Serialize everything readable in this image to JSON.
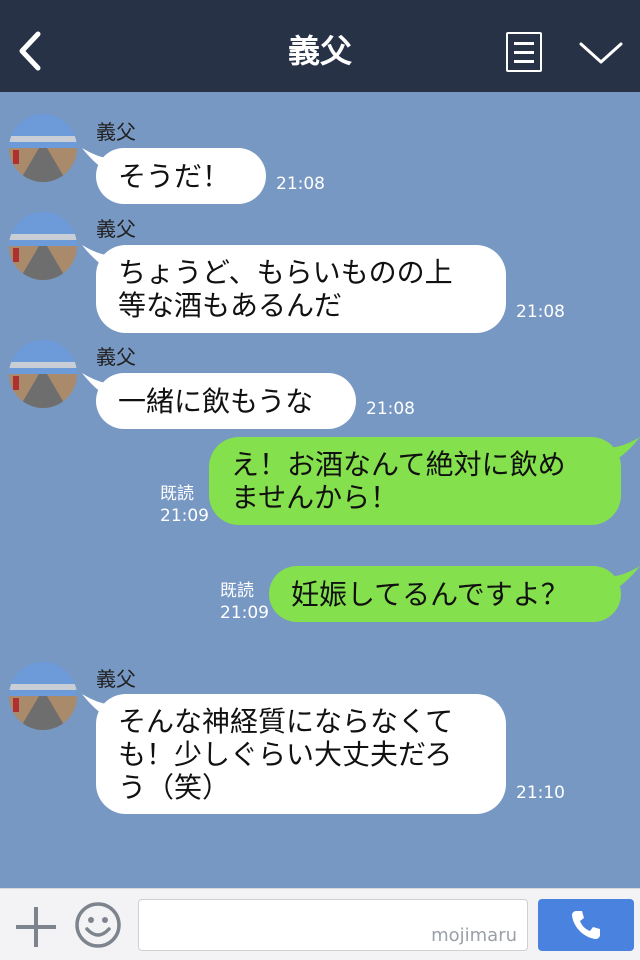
{
  "header": {
    "title": "義父"
  },
  "messages": [
    {
      "sender": "義父",
      "text": "そうだ！",
      "time": "21:08"
    },
    {
      "sender": "義父",
      "text": "ちょうど、もらいものの上\n等な酒もあるんだ",
      "time": "21:08"
    },
    {
      "sender": "義父",
      "text": "一緒に飲もうな",
      "time": "21:08"
    },
    {
      "read_label": "既読",
      "text": "え！お酒なんて絶対に飲め\nませんから！",
      "time": "21:09"
    },
    {
      "read_label": "既読",
      "text": "妊娠してるんですよ？",
      "time": "21:09"
    },
    {
      "sender": "義父",
      "text": "そんな神経質にならなくて\nも！少しぐらい大丈夫だろ\nう（笑）",
      "time": "21:10"
    }
  ],
  "footer": {
    "watermark": "mojimaru"
  },
  "colors": {
    "header": "#273246",
    "chat_bg": "#7898c4",
    "incoming_bubble": "#ffffff",
    "outgoing_bubble": "#84e04c",
    "call_button": "#4a82e0"
  }
}
